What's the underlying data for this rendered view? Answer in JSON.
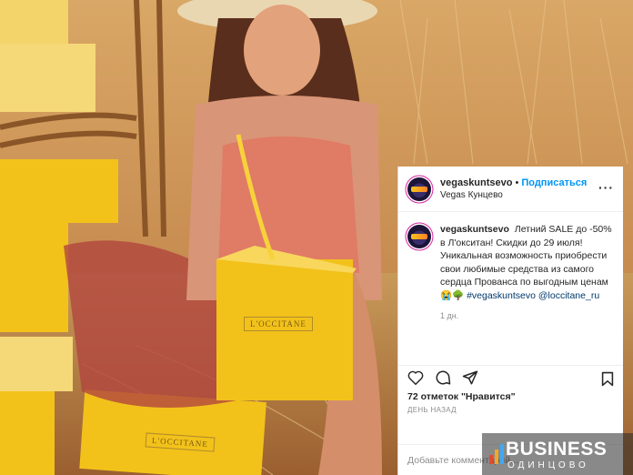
{
  "post": {
    "username": "vegaskuntsevo",
    "separator": "•",
    "follow_label": "Подписаться",
    "location": "Vegas Кунцево",
    "more_icon": "more-horizontal-icon",
    "caption_username": "vegaskuntsevo",
    "caption_text": "Летний SALE до -50% в Л'окситан! Скидки до 29 июля! Уникальная возможность приобрести свои любимые средства из самого сердца Прованса по выгодным ценам",
    "caption_emoji": "😭🌳",
    "hashtags": "#vegaskuntsevo @loccitane_ru",
    "caption_time": "1 дн.",
    "likes": "72 отметок \"Нравится\"",
    "date": "ДЕНЬ НАЗАД",
    "comment_placeholder": "Добавьте комментарий..."
  },
  "photo": {
    "box_logo": "L'OCCITANE",
    "box_logo_bottom": "L'OCCITANE"
  },
  "watermark": {
    "title": "BUSINESS",
    "subtitle": "ОДИНЦОВО",
    "bar_colors": [
      "#e64a2e",
      "#f5a623",
      "#3fa9f5"
    ]
  },
  "colors": {
    "follow": "#0095f6",
    "hashtag": "#00376b",
    "box_yellow": "#f2c21b"
  }
}
